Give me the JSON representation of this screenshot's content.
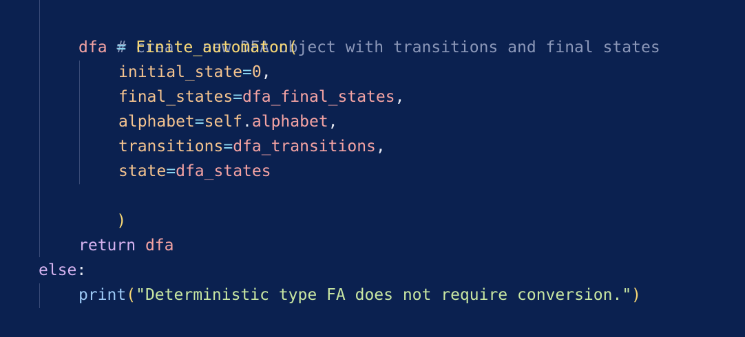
{
  "code": {
    "comment": "# create new DFA object with transitions and final states",
    "dfa_var": "dfa",
    "assign_op": " = ",
    "class_name": "Finite_automaton",
    "open_paren": "(",
    "close_paren": ")",
    "args": [
      {
        "name": "initial_state",
        "eq": "=",
        "value": "0",
        "trail": ","
      },
      {
        "name": "final_states",
        "eq": "=",
        "value": "dfa_final_states",
        "trail": ","
      },
      {
        "name": "alphabet",
        "eq": "=",
        "self": "self",
        "dot": ".",
        "value": "alphabet",
        "trail": ","
      },
      {
        "name": "transitions",
        "eq": "=",
        "value": "dfa_transitions",
        "trail": ","
      },
      {
        "name": "state",
        "eq": "=",
        "value": "dfa_states",
        "trail": ""
      }
    ],
    "return_kw": "return",
    "return_val": "dfa",
    "else_kw": "else",
    "else_colon": ":",
    "print_fn": "print",
    "print_open": "(",
    "print_string": "\"Deterministic type FA does not require conversion.\"",
    "print_close": ")"
  }
}
